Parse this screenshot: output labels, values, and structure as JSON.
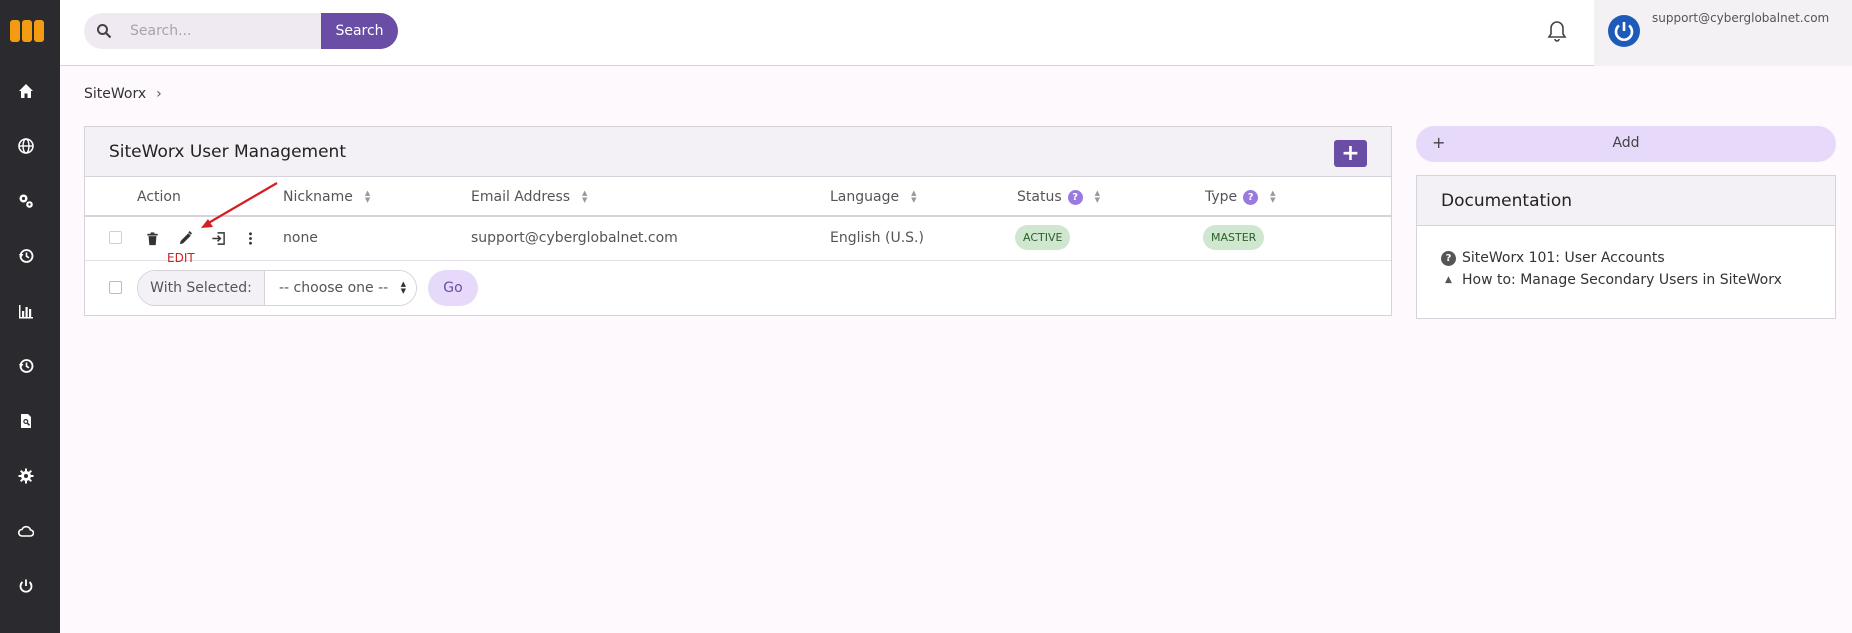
{
  "topbar": {
    "search_placeholder": "Search...",
    "search_button": "Search",
    "user_email": "support@cyberglobalnet.com"
  },
  "breadcrumb": {
    "item": "SiteWorx",
    "separator": "›"
  },
  "panel": {
    "title": "SiteWorx User Management",
    "add_symbol": "+",
    "columns": {
      "action": "Action",
      "nickname": "Nickname",
      "email": "Email Address",
      "language": "Language",
      "status": "Status",
      "type": "Type"
    },
    "help_symbol": "?",
    "rows": [
      {
        "nickname": "none",
        "email": "support@cyberglobalnet.com",
        "language": "English (U.S.)",
        "status": "ACTIVE",
        "type": "MASTER"
      }
    ],
    "edit_annotation": "EDIT",
    "bulk": {
      "label": "With Selected:",
      "select_value": "-- choose one --",
      "go": "Go"
    }
  },
  "right": {
    "add_plus": "+",
    "add_label": "Add",
    "doc_title": "Documentation",
    "doc_links": [
      "SiteWorx 101: User Accounts",
      "How to: Manage Secondary Users in SiteWorx"
    ]
  },
  "colors": {
    "accent": "#6a4ea6",
    "accent_light": "#e6d9fa",
    "sidebar": "#2b2b2f",
    "logo": "#f39c12",
    "status_badge": "#cfe6cf",
    "annotation": "#d42020"
  },
  "sidebar_icons": [
    "home-icon",
    "globe-icon",
    "cogs-icon",
    "history-icon",
    "bar-chart-icon",
    "backup-icon",
    "search-file-icon",
    "gear-icon",
    "cloud-icon",
    "power-icon"
  ]
}
